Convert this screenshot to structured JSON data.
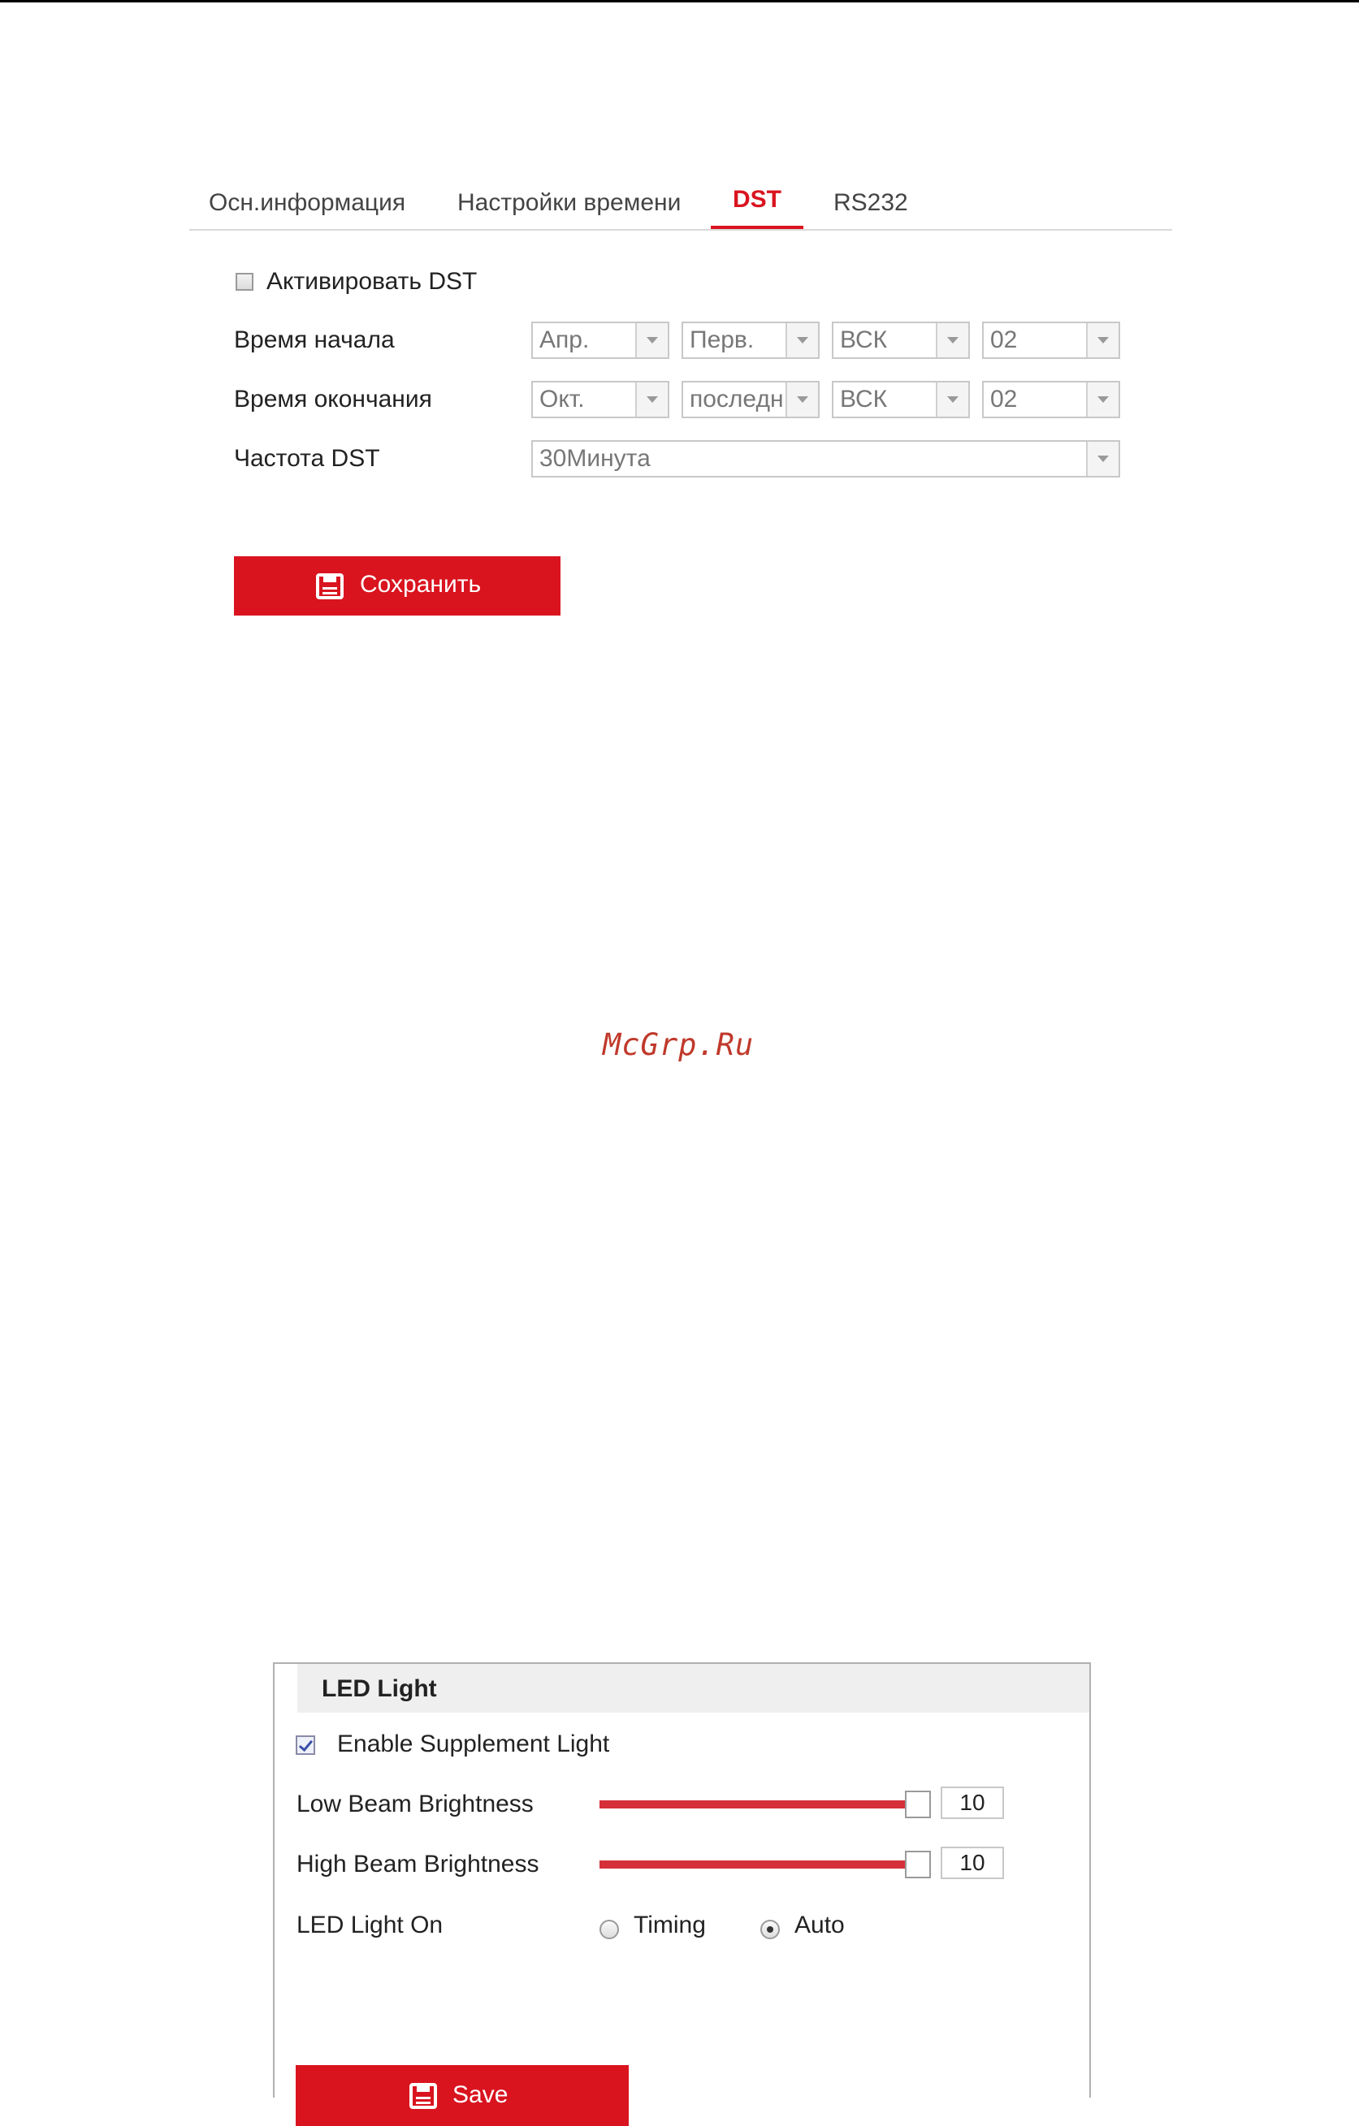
{
  "tabs": [
    {
      "label": "Осн.информация"
    },
    {
      "label": "Настройки времени"
    },
    {
      "label": "DST"
    },
    {
      "label": "RS232"
    }
  ],
  "active_tab": "DST",
  "dst": {
    "enable_label": "Активировать DST",
    "enable_checked": false,
    "start_label": "Время начала",
    "start": {
      "month": "Апр.",
      "week": "Перв.",
      "day": "ВСК",
      "hour": "02"
    },
    "end_label": "Время окончания",
    "end": {
      "month": "Окт.",
      "week": "последн",
      "day": "ВСК",
      "hour": "02"
    },
    "freq_label": "Частота DST",
    "freq_value": "30Минута",
    "save_label": "Сохранить"
  },
  "watermark": "McGrp.Ru",
  "led": {
    "title": "LED Light",
    "enable_label": "Enable Supplement Light",
    "enable_checked": true,
    "low_label": "Low Beam Brightness",
    "low_value": "10",
    "high_label": "High Beam Brightness",
    "high_value": "10",
    "on_label": "LED Light On",
    "options": [
      {
        "label": "Timing",
        "selected": false
      },
      {
        "label": "Auto",
        "selected": true
      }
    ],
    "save_label": "Save"
  },
  "colors": {
    "accent": "#d9141f",
    "slider": "#d5303a"
  },
  "icons": {
    "save": "floppy-disk-icon",
    "dropdown": "chevron-down-icon"
  }
}
